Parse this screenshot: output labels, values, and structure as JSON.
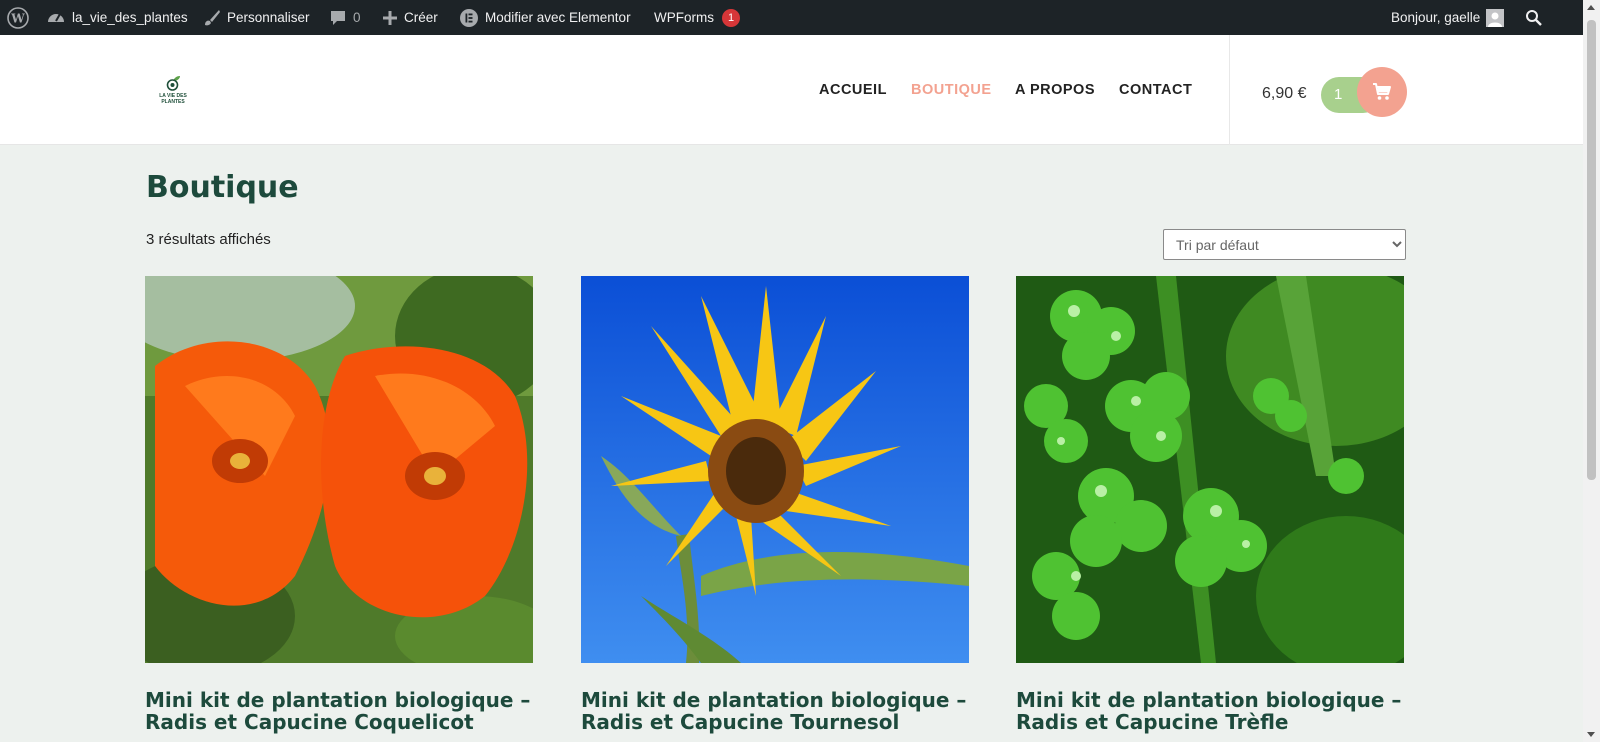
{
  "adminbar": {
    "site_name": "la_vie_des_plantes",
    "customize": "Personnaliser",
    "comments_count": "0",
    "new": "Créer",
    "elementor": "Modifier avec Elementor",
    "wpforms": "WPForms",
    "wpforms_badge": "1",
    "greeting": "Bonjour, gaelle"
  },
  "header": {
    "logo_text_1": "LA VIE DES",
    "logo_text_2": "PLANTES",
    "nav": [
      {
        "label": "ACCUEIL",
        "active": false
      },
      {
        "label": "BOUTIQUE",
        "active": true
      },
      {
        "label": "A PROPOS",
        "active": false
      },
      {
        "label": "CONTACT",
        "active": false
      }
    ],
    "cart_total": "6,90 €",
    "cart_count": "1"
  },
  "main": {
    "title": "Boutique",
    "result_count": "3 résultats affichés",
    "sort": {
      "selected": "Tri par défaut"
    },
    "products": [
      {
        "title_line1": "Mini kit de plantation biologique –",
        "title_line2": "Radis et Capucine Coquelicot",
        "image": "orange-nasturtium-flowers"
      },
      {
        "title_line1": "Mini kit de plantation biologique –",
        "title_line2": "Radis et Capucine Tournesol",
        "image": "sunflower-blue-sky"
      },
      {
        "title_line1": "Mini kit de plantation biologique –",
        "title_line2": "Radis et Capucine Trèfle",
        "image": "clover-with-dewdrops"
      }
    ]
  },
  "colors": {
    "adminbar_bg": "#1d2327",
    "accent_pink": "#f3a290",
    "accent_green": "#a8d08d",
    "title_green": "#1d4a3c",
    "page_bg": "#edf1ee"
  }
}
